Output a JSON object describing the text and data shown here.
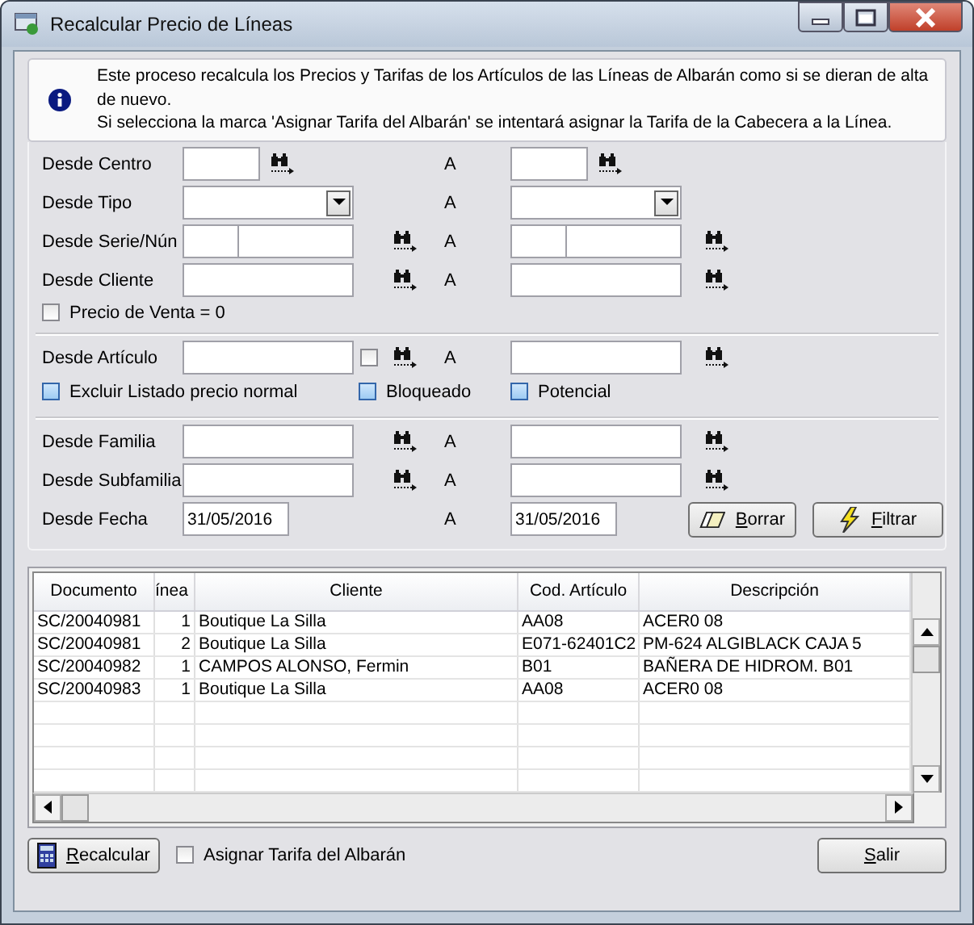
{
  "window": {
    "title": "Recalcular Precio de Líneas"
  },
  "info": {
    "lines": [
      "Este proceso recalcula los Precios y Tarifas de los Artículos de las Líneas de Albarán como si se dieran de alta de nuevo.",
      "Si selecciona la marca 'Asignar Tarifa del Albarán' se intentará asignar la Tarifa de la Cabecera a la Línea."
    ]
  },
  "filters": [
    {
      "kind": "small",
      "label": "Desde Centro",
      "to_label": "A"
    },
    {
      "kind": "combo",
      "label": "Desde Tipo",
      "to_label": "A"
    },
    {
      "kind": "serie",
      "label": "Desde Serie/Nún",
      "to_label": "A"
    },
    {
      "kind": "text",
      "label": "Desde Cliente",
      "to_label": "A"
    }
  ],
  "precio_cero": {
    "label": "Precio de Venta = 0",
    "checked": false
  },
  "articulo": {
    "label": "Desde Artículo",
    "to_label": "A",
    "checked": false
  },
  "options": [
    {
      "label": "Excluir Listado precio normal",
      "checked": false
    },
    {
      "label": "Bloqueado",
      "checked": false
    },
    {
      "label": "Potencial",
      "checked": false
    }
  ],
  "filters2": [
    {
      "kind": "text",
      "label": "Desde Familia",
      "to_label": "A"
    },
    {
      "kind": "text",
      "label": "Desde Subfamilia",
      "to_label": "A"
    },
    {
      "kind": "date",
      "label": "Desde Fecha",
      "to_label": "A",
      "from": "31/05/2016",
      "to": "31/05/2016"
    }
  ],
  "filter_buttons": [
    "Borrar",
    "Filtrar"
  ],
  "table": {
    "columns": [
      "Documento",
      "ínea",
      "Cliente",
      "Cod. Artículo",
      "Descripción"
    ],
    "rows": [
      [
        "SC/20040981",
        "1",
        "Boutique La Silla",
        "AA08",
        "ACER0 08"
      ],
      [
        "SC/20040981",
        "2",
        "Boutique La Silla",
        "E071-62401C2",
        "PM-624 ALGIBLACK CAJA 5"
      ],
      [
        "SC/20040982",
        "1",
        "CAMPOS ALONSO, Fermin",
        "B01",
        "BAÑERA DE HIDROM. B01"
      ],
      [
        "SC/20040983",
        "1",
        "Boutique La Silla",
        "AA08",
        "ACER0 08"
      ]
    ]
  },
  "recalcular": {
    "label": "Recalcular"
  },
  "asignar": {
    "label": "Asignar Tarifa del Albarán",
    "checked": false
  },
  "salir": {
    "label": "Salir"
  }
}
